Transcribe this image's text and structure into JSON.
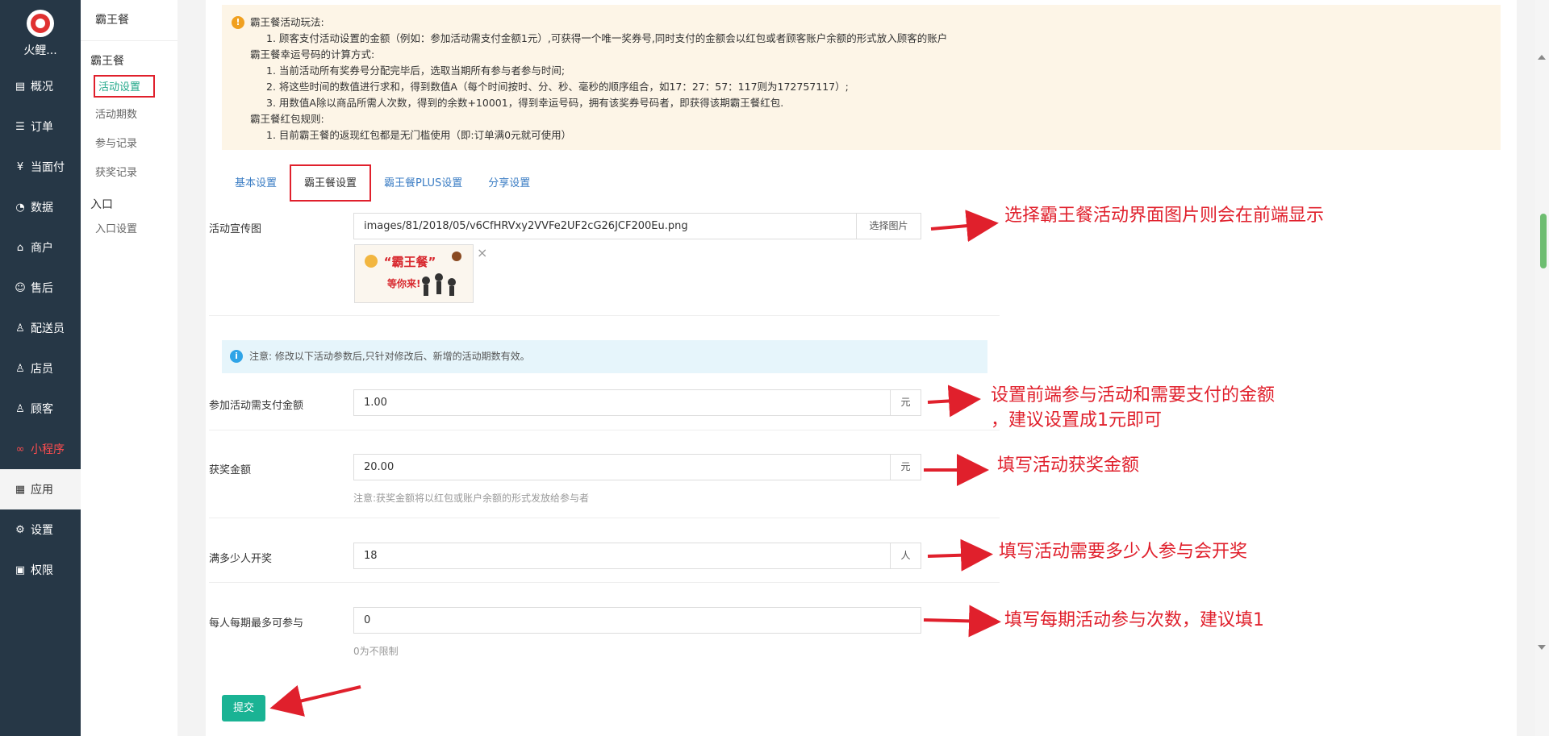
{
  "sidebar": {
    "logo_text": "火鲤...",
    "items": [
      {
        "label": "概况",
        "icon": "dashboard-icon"
      },
      {
        "label": "订单",
        "icon": "order-icon"
      },
      {
        "label": "当面付",
        "icon": "yen-icon"
      },
      {
        "label": "数据",
        "icon": "chart-icon"
      },
      {
        "label": "商户",
        "icon": "shop-icon"
      },
      {
        "label": "售后",
        "icon": "aftersale-icon"
      },
      {
        "label": "配送员",
        "icon": "courier-icon"
      },
      {
        "label": "店员",
        "icon": "clerk-icon"
      },
      {
        "label": "顾客",
        "icon": "customer-icon"
      },
      {
        "label": "小程序",
        "icon": "miniprogram-icon"
      },
      {
        "label": "应用",
        "icon": "apps-icon"
      },
      {
        "label": "设置",
        "icon": "gear-icon"
      },
      {
        "label": "权限",
        "icon": "lock-icon"
      }
    ]
  },
  "subnav": {
    "title": "霸王餐",
    "group1": "霸王餐",
    "items1": [
      "活动设置",
      "活动期数",
      "参与记录",
      "获奖记录"
    ],
    "group2": "入口",
    "items2": [
      "入口设置"
    ]
  },
  "notice": {
    "lines": [
      "霸王餐活动玩法:",
      "1. 顾客支付活动设置的金额（例如：参加活动需支付金额1元）,可获得一个唯一奖券号,同时支付的金额会以红包或者顾客账户余额的形式放入顾客的账户",
      "霸王餐幸运号码的计算方式:",
      "1. 当前活动所有奖券号分配完毕后，选取当期所有参与者参与时间;",
      "2. 将这些时间的数值进行求和，得到数值A（每个时间按时、分、秒、毫秒的顺序组合，如17：27：57：117则为172757117）;",
      "3. 用数值A除以商品所需人次数，得到的余数+10001，得到幸运号码，拥有该奖券号码者，即获得该期霸王餐红包.",
      "霸王餐红包规则:",
      "1. 目前霸王餐的返现红包都是无门槛使用（即:订单满0元就可使用）"
    ]
  },
  "tabs": [
    "基本设置",
    "霸王餐设置",
    "霸王餐PLUS设置",
    "分享设置"
  ],
  "form": {
    "banner_label": "活动宣传图",
    "banner_value": "images/81/2018/05/v6CfHRVxy2VVFe2UF2cG26JCF200Eu.png",
    "choose_image": "选择图片",
    "thumb_text_top": "“霸王餐”",
    "thumb_text_bottom": "等你来!",
    "info_note": "注意: 修改以下活动参数后,只针对修改后、新增的活动期数有效。",
    "pay_label": "参加活动需支付金额",
    "pay_value": "1.00",
    "pay_unit": "元",
    "prize_label": "获奖金额",
    "prize_value": "20.00",
    "prize_unit": "元",
    "prize_hint": "注意:获奖金额将以红包或账户余额的形式发放给参与者",
    "people_label": "满多少人开奖",
    "people_value": "18",
    "people_unit": "人",
    "limit_label": "每人每期最多可参与",
    "limit_value": "0",
    "limit_hint": "0为不限制",
    "submit": "提交"
  },
  "annotations": {
    "a1": "选择霸王餐活动界面图片则会在前端显示",
    "a2_line1": "设置前端参与活动和需要支付的金额",
    "a2_line2": "，建议设置成1元即可",
    "a3": "填写活动获奖金额",
    "a4": "填写活动需要多少人参与会开奖",
    "a5": "填写每期活动参与次数，建议填1"
  },
  "colors": {
    "sidebar_bg": "#263746",
    "accent_green": "#1ab394",
    "annotation_red": "#e0202c",
    "link_blue": "#3b7dc4"
  }
}
